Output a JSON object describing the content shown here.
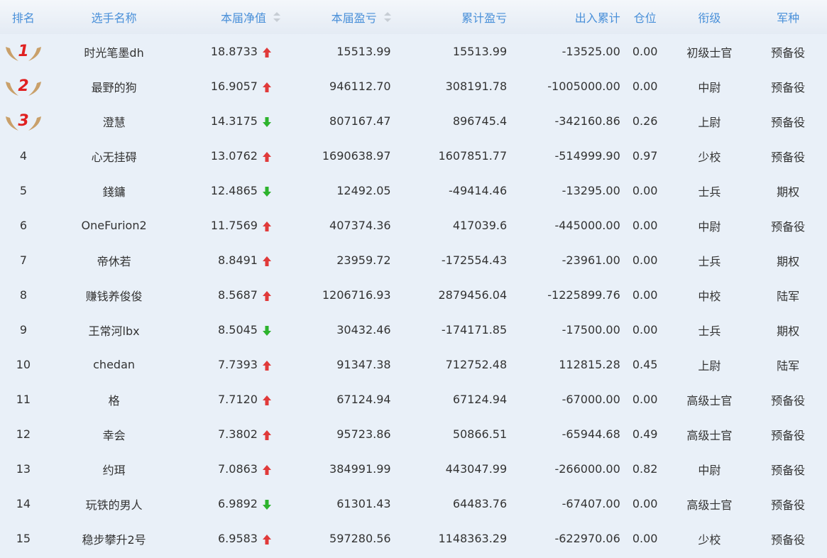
{
  "header": {
    "rank": "排名",
    "name": "选手名称",
    "net_value": "本届净值",
    "profit": "本届盈亏",
    "total_profit": "累计盈亏",
    "inout": "出入累计",
    "position": "仓位",
    "rank_title": "衔级",
    "arm": "军种"
  },
  "colors": {
    "up": "#e03a3a",
    "down": "#2db32d",
    "header_text": "#4a90d9",
    "medal": "#c9a06a",
    "medal_number": "#e02020"
  },
  "rows": [
    {
      "rank": "1",
      "medal": true,
      "name": "时光笔墨dh",
      "net": "18.8733",
      "trend": "up",
      "profit": "15513.99",
      "total": "15513.99",
      "inout": "-13525.00",
      "pos": "0.00",
      "title": "初级士官",
      "arm": "预备役"
    },
    {
      "rank": "2",
      "medal": true,
      "name": "最野的狗",
      "net": "16.9057",
      "trend": "up",
      "profit": "946112.70",
      "total": "308191.78",
      "inout": "-1005000.00",
      "pos": "0.00",
      "title": "中尉",
      "arm": "预备役"
    },
    {
      "rank": "3",
      "medal": true,
      "name": "澄慧",
      "net": "14.3175",
      "trend": "down",
      "profit": "807167.47",
      "total": "896745.4",
      "inout": "-342160.86",
      "pos": "0.26",
      "title": "上尉",
      "arm": "预备役"
    },
    {
      "rank": "4",
      "medal": false,
      "name": "心无挂碍",
      "net": "13.0762",
      "trend": "up",
      "profit": "1690638.97",
      "total": "1607851.77",
      "inout": "-514999.90",
      "pos": "0.97",
      "title": "少校",
      "arm": "预备役"
    },
    {
      "rank": "5",
      "medal": false,
      "name": "錢鏞",
      "net": "12.4865",
      "trend": "down",
      "profit": "12492.05",
      "total": "-49414.46",
      "inout": "-13295.00",
      "pos": "0.00",
      "title": "士兵",
      "arm": "期权"
    },
    {
      "rank": "6",
      "medal": false,
      "name": "OneFurion2",
      "net": "11.7569",
      "trend": "up",
      "profit": "407374.36",
      "total": "417039.6",
      "inout": "-445000.00",
      "pos": "0.00",
      "title": "中尉",
      "arm": "预备役"
    },
    {
      "rank": "7",
      "medal": false,
      "name": "帝休若",
      "net": "8.8491",
      "trend": "up",
      "profit": "23959.72",
      "total": "-172554.43",
      "inout": "-23961.00",
      "pos": "0.00",
      "title": "士兵",
      "arm": "期权"
    },
    {
      "rank": "8",
      "medal": false,
      "name": "赚钱养俊俊",
      "net": "8.5687",
      "trend": "up",
      "profit": "1206716.93",
      "total": "2879456.04",
      "inout": "-1225899.76",
      "pos": "0.00",
      "title": "中校",
      "arm": "陆军"
    },
    {
      "rank": "9",
      "medal": false,
      "name": "王常河lbx",
      "net": "8.5045",
      "trend": "down",
      "profit": "30432.46",
      "total": "-174171.85",
      "inout": "-17500.00",
      "pos": "0.00",
      "title": "士兵",
      "arm": "期权"
    },
    {
      "rank": "10",
      "medal": false,
      "name": "chedan",
      "net": "7.7393",
      "trend": "up",
      "profit": "91347.38",
      "total": "712752.48",
      "inout": "112815.28",
      "pos": "0.45",
      "title": "上尉",
      "arm": "陆军"
    },
    {
      "rank": "11",
      "medal": false,
      "name": "格",
      "net": "7.7120",
      "trend": "up",
      "profit": "67124.94",
      "total": "67124.94",
      "inout": "-67000.00",
      "pos": "0.00",
      "title": "高级士官",
      "arm": "预备役"
    },
    {
      "rank": "12",
      "medal": false,
      "name": "幸会",
      "net": "7.3802",
      "trend": "up",
      "profit": "95723.86",
      "total": "50866.51",
      "inout": "-65944.68",
      "pos": "0.49",
      "title": "高级士官",
      "arm": "预备役"
    },
    {
      "rank": "13",
      "medal": false,
      "name": "约珥",
      "net": "7.0863",
      "trend": "up",
      "profit": "384991.99",
      "total": "443047.99",
      "inout": "-266000.00",
      "pos": "0.82",
      "title": "中尉",
      "arm": "预备役"
    },
    {
      "rank": "14",
      "medal": false,
      "name": "玩铁的男人",
      "net": "6.9892",
      "trend": "down",
      "profit": "61301.43",
      "total": "64483.76",
      "inout": "-67407.00",
      "pos": "0.00",
      "title": "高级士官",
      "arm": "预备役"
    },
    {
      "rank": "15",
      "medal": false,
      "name": "稳步攀升2号",
      "net": "6.9583",
      "trend": "up",
      "profit": "597280.56",
      "total": "1148363.29",
      "inout": "-622970.06",
      "pos": "0.00",
      "title": "少校",
      "arm": "预备役"
    }
  ]
}
